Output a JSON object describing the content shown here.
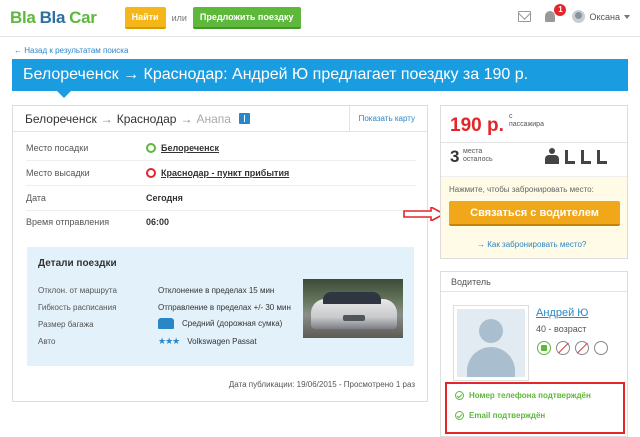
{
  "header": {
    "logo_part1": "Bla",
    "logo_part2": "Bla",
    "logo_part3": "Car",
    "find_label": "Найти",
    "or_label": "или",
    "offer_label": "Предложить поездку",
    "notification_count": "1",
    "user_name": "Оксана"
  },
  "nav": {
    "back_label": "← Назад к результатам поиска"
  },
  "trip": {
    "title": "Белореченск → Краснодар: Андрей Ю предлагает поездку за 190 р.",
    "route_from": "Белореченск",
    "route_to": "Краснодар",
    "route_next": "Анапа",
    "arrow": "→",
    "show_map": "Показать карту",
    "pickup_label": "Место посадки",
    "pickup_value": "Белореченск",
    "dropoff_label": "Место высадки",
    "dropoff_value": "Краснодар - пункт прибытия",
    "date_label": "Дата",
    "date_value": "Сегодня",
    "time_label": "Время отправления",
    "time_value": "06:00"
  },
  "details": {
    "title": "Детали поездки",
    "route_dev_label": "Отклон. от маршрута",
    "route_dev_value": "Отклонение в пределах 15 мин",
    "schedule_label": "Гибкость расписания",
    "schedule_value": "Отправление в пределах +/- 30 мин",
    "luggage_label": "Размер багажа",
    "luggage_value": "Средний (дорожная сумка)",
    "car_label": "Авто",
    "car_stars": "★★★",
    "car_value": "Volkswagen Passat"
  },
  "published": "Дата публикации: 19/06/2015 - Просмотрено 1 раз",
  "booking": {
    "price": "190 р.",
    "per_line1": "с",
    "per_line2": "пассажира",
    "seats_count": "3",
    "seats_line1": "места",
    "seats_line2": "осталось",
    "hint": "Нажмите, чтобы забронировать место:",
    "contact_label": "Связаться с водителем",
    "how_label": "→ Как забронировать место?"
  },
  "driver": {
    "header": "Водитель",
    "name": "Андрей Ю",
    "age": "40 - возраст",
    "phone_verified": "Номер телефона подтверждён",
    "email_verified": "Email подтверждён"
  },
  "colors": {
    "brand_green": "#5db83c",
    "brand_blue": "#1a9de0",
    "accent_orange": "#f0a81a",
    "alert_red": "#e3262a"
  }
}
